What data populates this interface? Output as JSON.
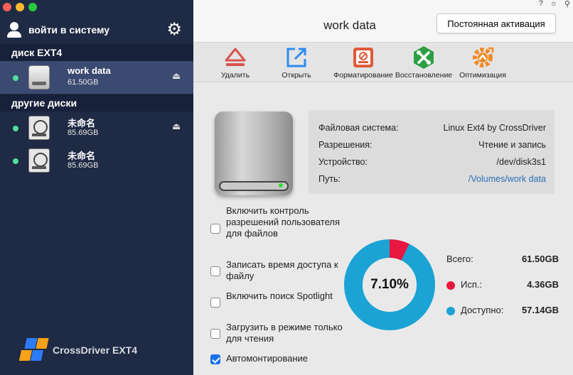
{
  "sidebar": {
    "login_label": "войти в систему",
    "sections": [
      {
        "title": "диск EXT4"
      },
      {
        "title": "другие диски"
      }
    ],
    "disks": [
      {
        "name": "work data",
        "size": "61.50GB",
        "icon": "external-disk-icon",
        "selected": true,
        "ejectable": true
      },
      {
        "name": "未命名",
        "size": "85.69GB",
        "icon": "hard-drive-icon",
        "selected": false,
        "ejectable": true
      },
      {
        "name": "未命名",
        "size": "85.69GB",
        "icon": "hard-drive-icon",
        "selected": false,
        "ejectable": false
      }
    ],
    "brand": "CrossDriver EXT4"
  },
  "header": {
    "title": "work data",
    "activate_label": "Постоянная активация",
    "icons": [
      "help-icon",
      "brightness-icon",
      "pin-icon"
    ]
  },
  "toolbar": {
    "items": [
      {
        "label": "Удалить",
        "icon": "eject-icon",
        "color": "#d9534f"
      },
      {
        "label": "Открыть",
        "icon": "open-external-icon",
        "color": "#2d8cf0"
      },
      {
        "label": "Форматирование",
        "icon": "format-icon",
        "color": "#e05a3a"
      },
      {
        "label": "Восстановление",
        "icon": "repair-icon",
        "color": "#2ea043"
      },
      {
        "label": "Оптимизация",
        "icon": "optimize-icon",
        "color": "#f08a24"
      }
    ]
  },
  "info": {
    "rows": [
      {
        "key": "Файловая система:",
        "value": "Linux Ext4 by CrossDriver"
      },
      {
        "key": "Разрешения:",
        "value": "Чтение и запись"
      },
      {
        "key": "Устройство:",
        "value": "/dev/disk3s1"
      },
      {
        "key": "Путь:",
        "value": "/Volumes/work data"
      }
    ]
  },
  "options": [
    {
      "label": "Включить контроль разрешений пользователя для файлов",
      "checked": false
    },
    {
      "label": "Записать время доступа к файлу",
      "checked": false
    },
    {
      "label": "Включить поиск Spotlight",
      "checked": false
    },
    {
      "label": "Загрузить в режиме только для чтения",
      "checked": false
    },
    {
      "label": "Автомонтирование",
      "checked": true
    }
  ],
  "usage": {
    "percent_label": "7.10%",
    "used_fraction": 0.071,
    "total_label": "Всего:",
    "total_value": "61.50GB",
    "used_label": "Исп.:",
    "used_value": "4.36GB",
    "free_label": "Доступно:",
    "free_value": "57.14GB",
    "used_color": "#e8173f",
    "free_color": "#1aa3d4"
  }
}
